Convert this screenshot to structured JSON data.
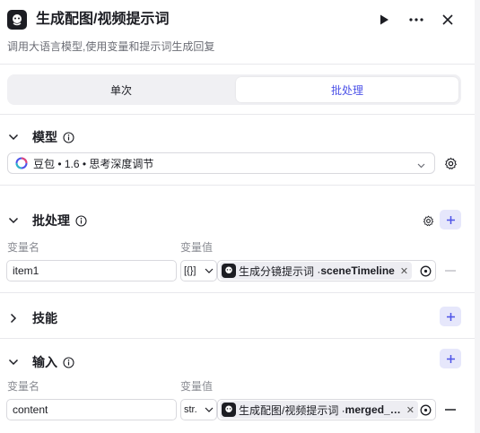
{
  "header": {
    "title": "生成配图/视频提示词",
    "subtitle": "调用大语言模型,使用变量和提示词生成回复"
  },
  "tabs": [
    {
      "label": "单次",
      "active": false
    },
    {
      "label": "批处理",
      "active": true
    }
  ],
  "model": {
    "section_title": "模型",
    "selected": "豆包 • 1.6 • 思考深度调节"
  },
  "batch": {
    "section_title": "批处理",
    "col_name": "变量名",
    "col_value": "变量值",
    "rows": [
      {
        "name": "item1",
        "type": "[{}]",
        "ref_node": "生成分镜提示词 · ",
        "ref_var": "sceneTimeline"
      }
    ]
  },
  "skills": {
    "section_title": "技能"
  },
  "input": {
    "section_title": "输入",
    "col_name": "变量名",
    "col_value": "变量值",
    "rows": [
      {
        "name": "content",
        "type": "str.",
        "ref_node": "生成配图/视频提示词 · ",
        "ref_var": "merged_…"
      }
    ]
  },
  "colors": {
    "accent": "#4d53e8",
    "plus_bg": "#e6e7fb"
  }
}
